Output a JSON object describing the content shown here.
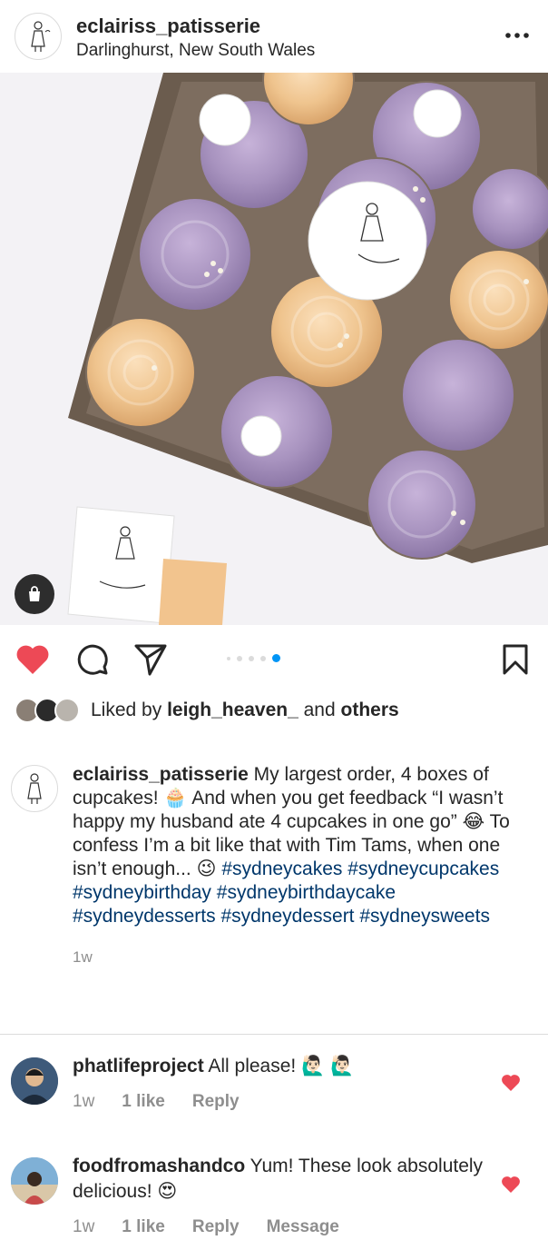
{
  "header": {
    "username": "eclairiss_patisserie",
    "location": "Darlinghurst, New South Wales",
    "more_icon": "more-horizontal-icon"
  },
  "post": {
    "image_alt": "Box of lavender and caramel cupcakes with Eclairiss Patisserie toppers",
    "carousel_count": 5,
    "carousel_active": 4
  },
  "colors": {
    "like_red": "#ed4956",
    "hashtag_blue": "#00376b",
    "carousel_blue": "#0095f6",
    "muted": "#8e8e8e"
  },
  "likes": {
    "prefix": "Liked by ",
    "user": "leigh_heaven_",
    "middle": " and ",
    "others": "others"
  },
  "caption": {
    "username": "eclairiss_patisserie",
    "text_1": " My largest order, 4 boxes of cupcakes! ",
    "emoji_1": "🧁",
    "text_2": " And when you get feedback “I wasn’t happy my husband ate 4 cupcakes in one go” ",
    "emoji_2": "😂",
    "text_3": " To confess I’m a bit like that with Tim Tams, when one isn’t enough... ",
    "emoji_3": "😉",
    "hashtags": [
      "#sydneycakes",
      "#sydneycupcakes",
      "#sydneybirthday",
      "#sydneybirthdaycake",
      "#sydneydesserts",
      "#sydneydessert",
      "#sydneysweets"
    ],
    "time": "1w"
  },
  "comments": [
    {
      "username": "phatlifeproject",
      "text": " All please! 🙋🏻‍♂️ 🙋🏻‍♂️",
      "time": "1w",
      "likes": "1 like",
      "reply": "Reply"
    },
    {
      "username": "foodfromashandco",
      "text": " Yum! These look absolutely delicious! 😍",
      "time": "1w",
      "likes": "1 like",
      "reply": "Reply",
      "message": "Message"
    }
  ]
}
